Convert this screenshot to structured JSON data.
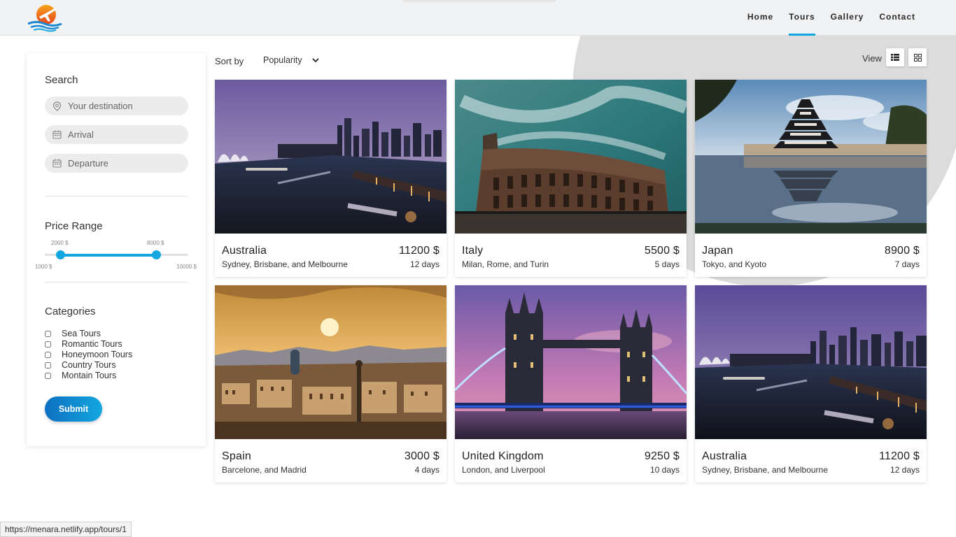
{
  "nav": {
    "items": [
      {
        "label": "Home"
      },
      {
        "label": "Tours"
      },
      {
        "label": "Gallery"
      },
      {
        "label": "Contact"
      }
    ],
    "active": "Tours"
  },
  "sidebar": {
    "search_title": "Search",
    "destination_placeholder": "Your destination",
    "arrival_placeholder": "Arrival",
    "departure_placeholder": "Departure",
    "price_title": "Price Range",
    "price": {
      "min_label": "1000 $",
      "max_label": "10000 $",
      "low_label": "2000 $",
      "high_label": "8000 $",
      "min": 1000,
      "max": 10000,
      "low": 2000,
      "high": 8000
    },
    "categories_title": "Categories",
    "categories": [
      {
        "label": "Sea Tours"
      },
      {
        "label": "Romantic Tours"
      },
      {
        "label": "Honeymoon Tours"
      },
      {
        "label": "Country Tours"
      },
      {
        "label": "Montain Tours"
      }
    ],
    "submit_label": "Submit"
  },
  "toolbar": {
    "sort_label": "Sort by",
    "sort_value": "Popularity",
    "view_label": "View"
  },
  "tours": [
    {
      "country": "Australia",
      "cities": "Sydney, Brisbane, and Melbourne",
      "price": "11200 $",
      "days": "12 days",
      "image": "sydney-harbour-night"
    },
    {
      "country": "Italy",
      "cities": "Milan, Rome, and Turin",
      "price": "5500 $",
      "days": "5 days",
      "image": "colosseum"
    },
    {
      "country": "Japan",
      "cities": "Tokyo, and Kyoto",
      "price": "8900 $",
      "days": "7 days",
      "image": "japanese-castle"
    },
    {
      "country": "Spain",
      "cities": "Barcelone, and Madrid",
      "price": "3000 $",
      "days": "4 days",
      "image": "barcelona-sunset"
    },
    {
      "country": "United Kingdom",
      "cities": "London, and Liverpool",
      "price": "9250 $",
      "days": "10 days",
      "image": "tower-bridge"
    },
    {
      "country": "Australia",
      "cities": "Sydney, Brisbane, and Melbourne",
      "price": "11200 $",
      "days": "12 days",
      "image": "sydney-harbour-night"
    }
  ],
  "status_url": "https://menara.netlify.app/tours/1",
  "colors": {
    "accent": "#12a7e0",
    "accent_dark": "#0d6fc0",
    "background_circle": "#dcdcdc"
  }
}
